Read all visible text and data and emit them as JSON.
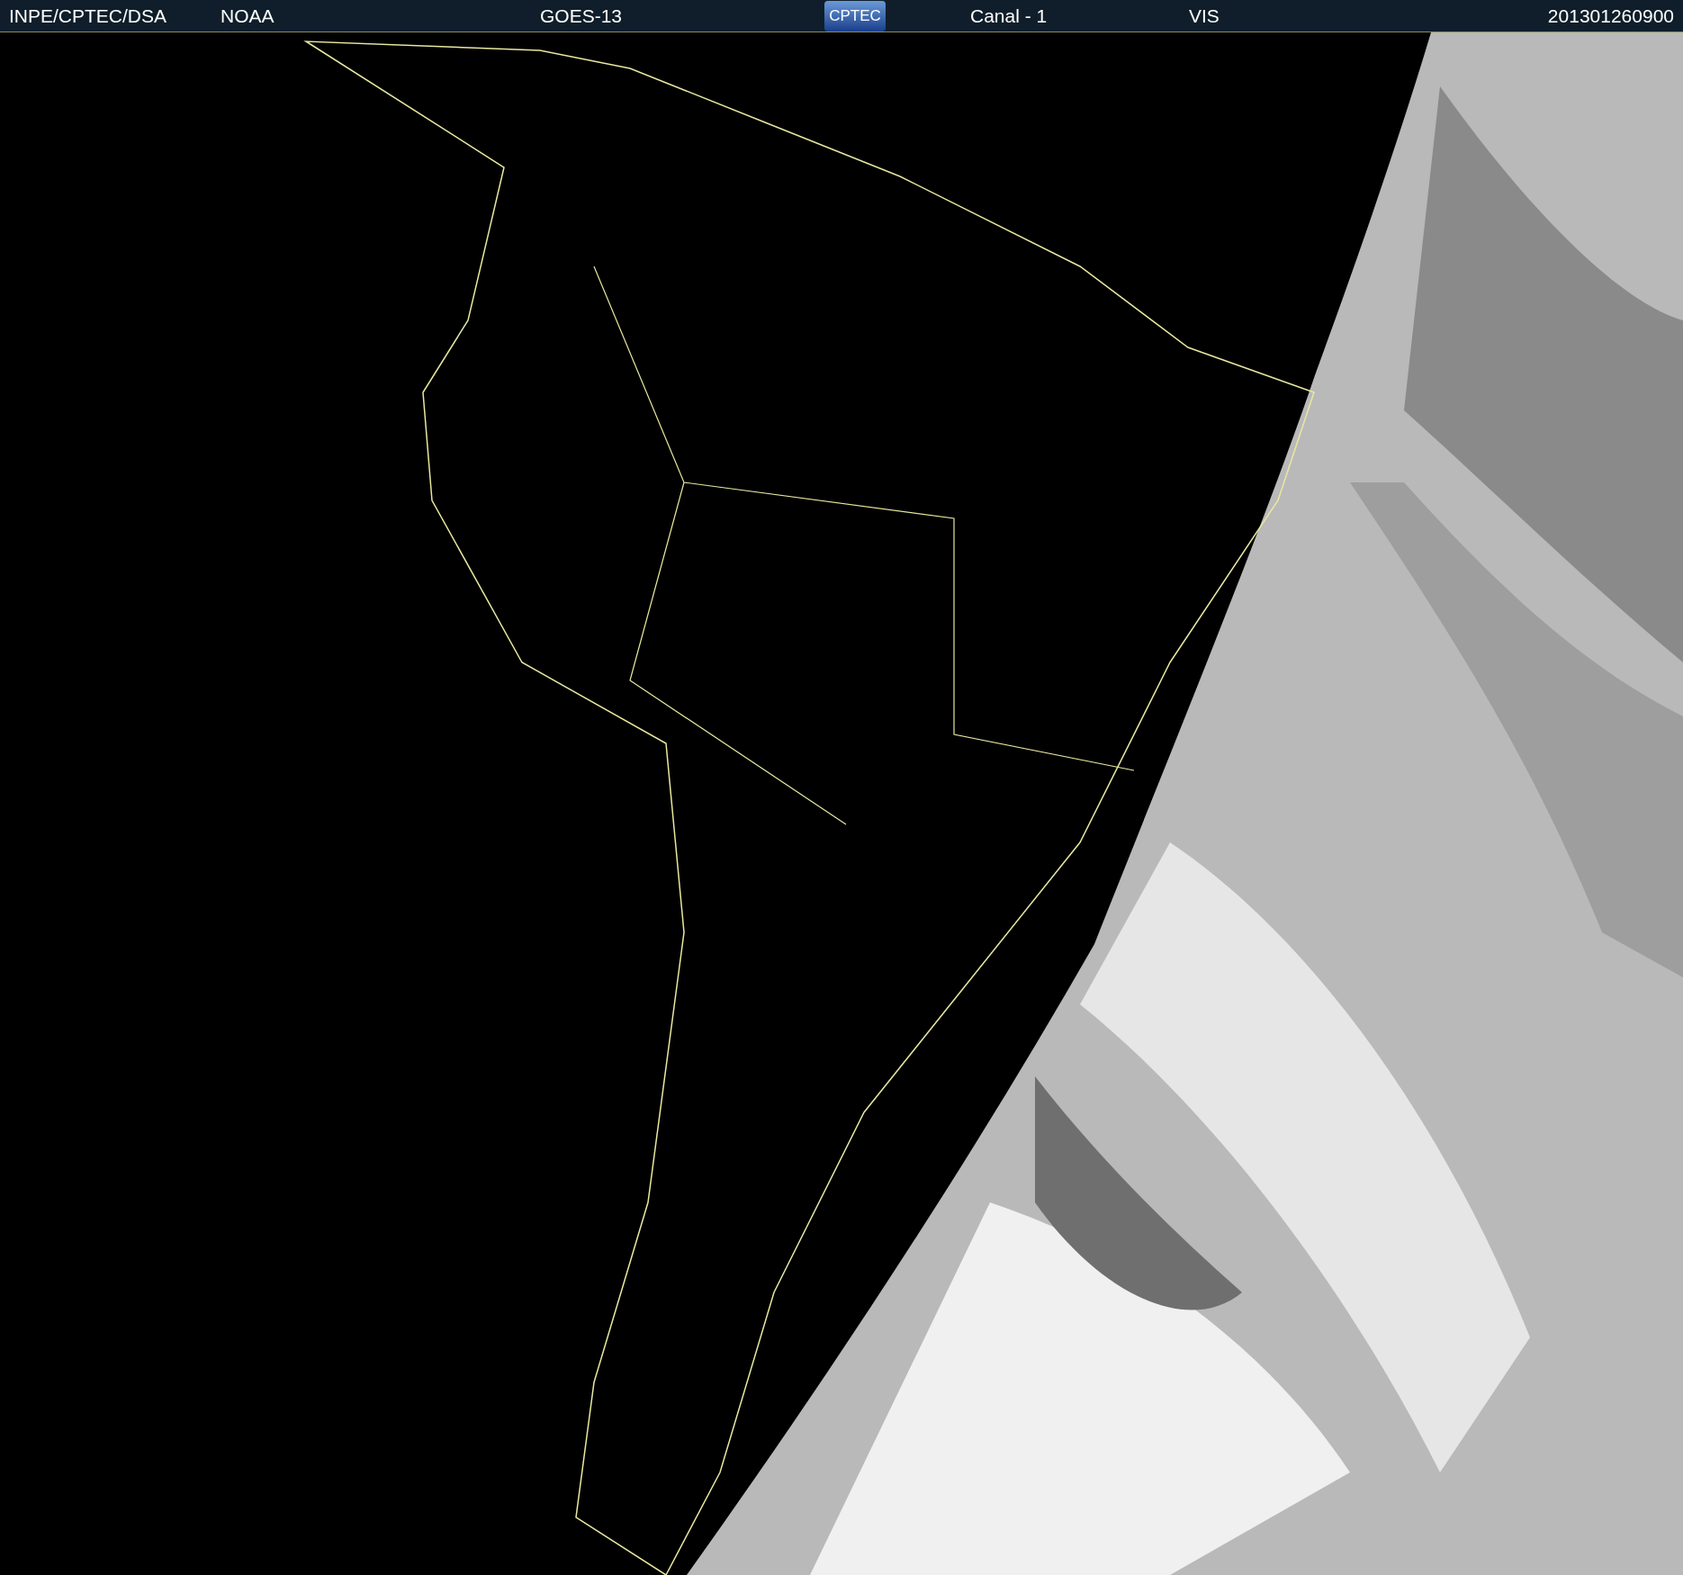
{
  "header": {
    "source": "INPE/CPTEC/DSA",
    "agency": "NOAA",
    "satellite": "GOES-13",
    "logo": "CPTEC",
    "channel": "Canal - 1",
    "band": "VIS",
    "timestamp": "201301260900"
  }
}
